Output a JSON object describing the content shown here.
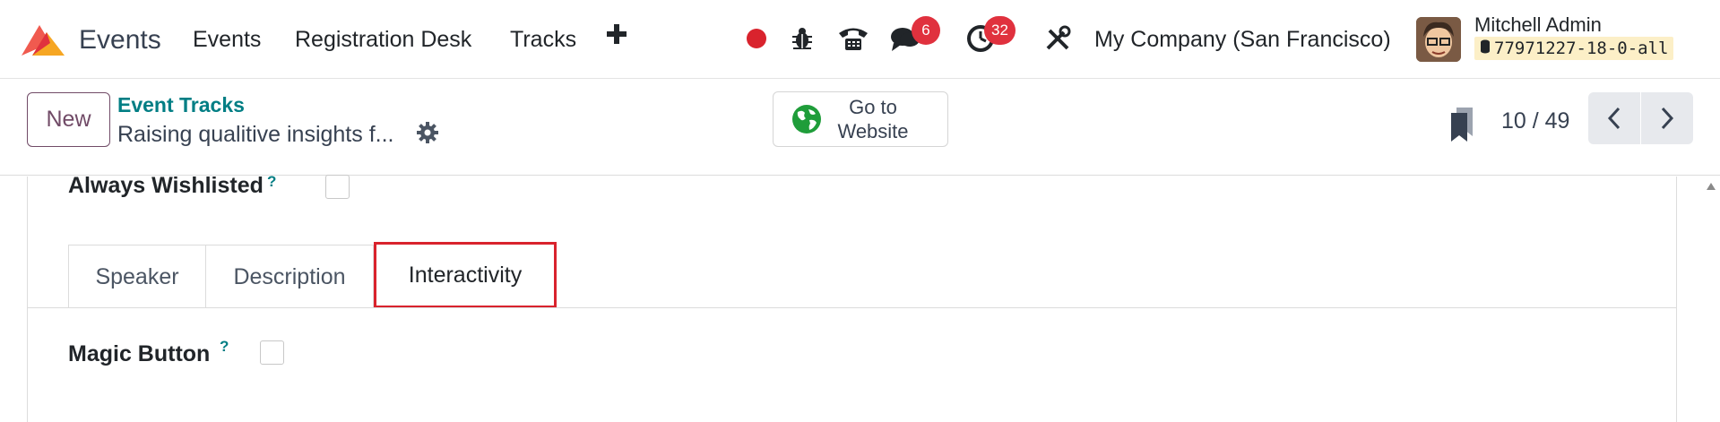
{
  "navbar": {
    "app_name": "Events",
    "menu": [
      {
        "label": "Events"
      },
      {
        "label": "Registration Desk"
      },
      {
        "label": "Tracks"
      }
    ],
    "plus_icon": "plus-icon",
    "messages_badge": "6",
    "activities_badge": "32",
    "company": "My Company (San Francisco)",
    "user_name": "Mitchell Admin",
    "database": "77971227-18-0-all"
  },
  "control_panel": {
    "new_label": "New",
    "breadcrumb": "Event Tracks",
    "record_name": "Raising qualitive insights f...",
    "website_label": "Go to Website",
    "pager": "10 / 49"
  },
  "form": {
    "always_wishlisted_label": "Always Wishlisted",
    "help_mark": "?",
    "tabs": [
      {
        "label": "Speaker"
      },
      {
        "label": "Description"
      },
      {
        "label": "Interactivity"
      }
    ],
    "magic_button_label": "Magic Button"
  },
  "colors": {
    "brand": "#714b67",
    "link": "#017e84",
    "badge": "#e0313e",
    "recording_dot": "#d9232d",
    "highlight_box": "#d9232d"
  }
}
